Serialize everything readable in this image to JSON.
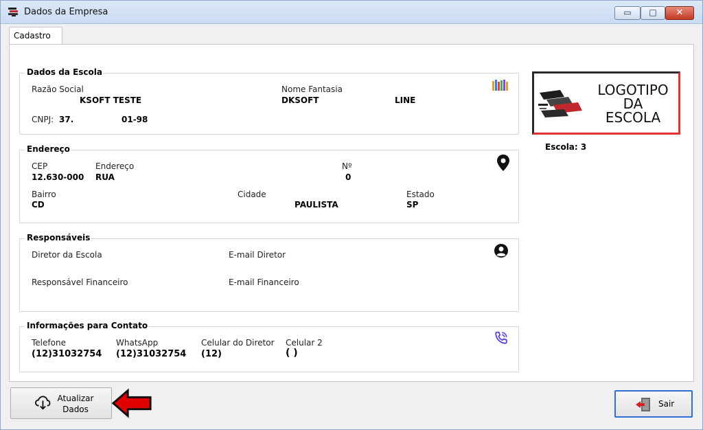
{
  "window": {
    "title": "Dados da Empresa"
  },
  "tabs": [
    {
      "label": "Cadastro"
    }
  ],
  "dados_escola": {
    "title": "Dados da Escola",
    "razao_social_label": "Razão Social",
    "razao_social_value": "KSOFT TESTE",
    "nome_fantasia_label": "Nome Fantasia",
    "nome_fantasia_value": "DKSOFT",
    "nome_fantasia_value2": "LINE",
    "cnpj_label": "CNPJ:",
    "cnpj_value": "37.",
    "cnpj_value2": "01-98",
    "icon": "books-icon"
  },
  "endereco": {
    "title": "Endereço",
    "cep_label": "CEP",
    "cep_value": "12.630-000",
    "endereco_label": "Endereço",
    "endereco_value": "RUA",
    "numero_label": "Nº",
    "numero_value": "0",
    "bairro_label": "Bairro",
    "bairro_value": "CD",
    "cidade_label": "Cidade",
    "cidade_value": "PAULISTA",
    "estado_label": "Estado",
    "estado_value": "SP",
    "icon": "map-pin-icon"
  },
  "responsaveis": {
    "title": "Responsáveis",
    "diretor_label": "Diretor da Escola",
    "email_diretor_label": "E-mail Diretor",
    "financeiro_label": "Responsável Financeiro",
    "email_financeiro_label": "E-mail Financeiro",
    "icon": "user-circle-icon"
  },
  "contato": {
    "title": "Informações para Contato",
    "telefone_label": "Telefone",
    "telefone_value": "(12)31032754",
    "whatsapp_label": "WhatsApp",
    "whatsapp_value": "(12)31032754",
    "celular_diretor_label": "Celular do Diretor",
    "celular_diretor_value": "(12)",
    "celular2_label": "Celular 2",
    "celular2_value": "( )",
    "icon": "phone-icon"
  },
  "logo": {
    "line1": "LOGOTIPO",
    "line2": "DA",
    "line3": "ESCOLA"
  },
  "escola": {
    "label": "Escola: 3"
  },
  "buttons": {
    "atualizar_line1": "Atualizar",
    "atualizar_line2": "Dados",
    "sair": "Sair"
  },
  "colors": {
    "accent_red": "#e53030",
    "focus_blue": "#2a6fd6",
    "icon_purple": "#5b3fd6"
  }
}
